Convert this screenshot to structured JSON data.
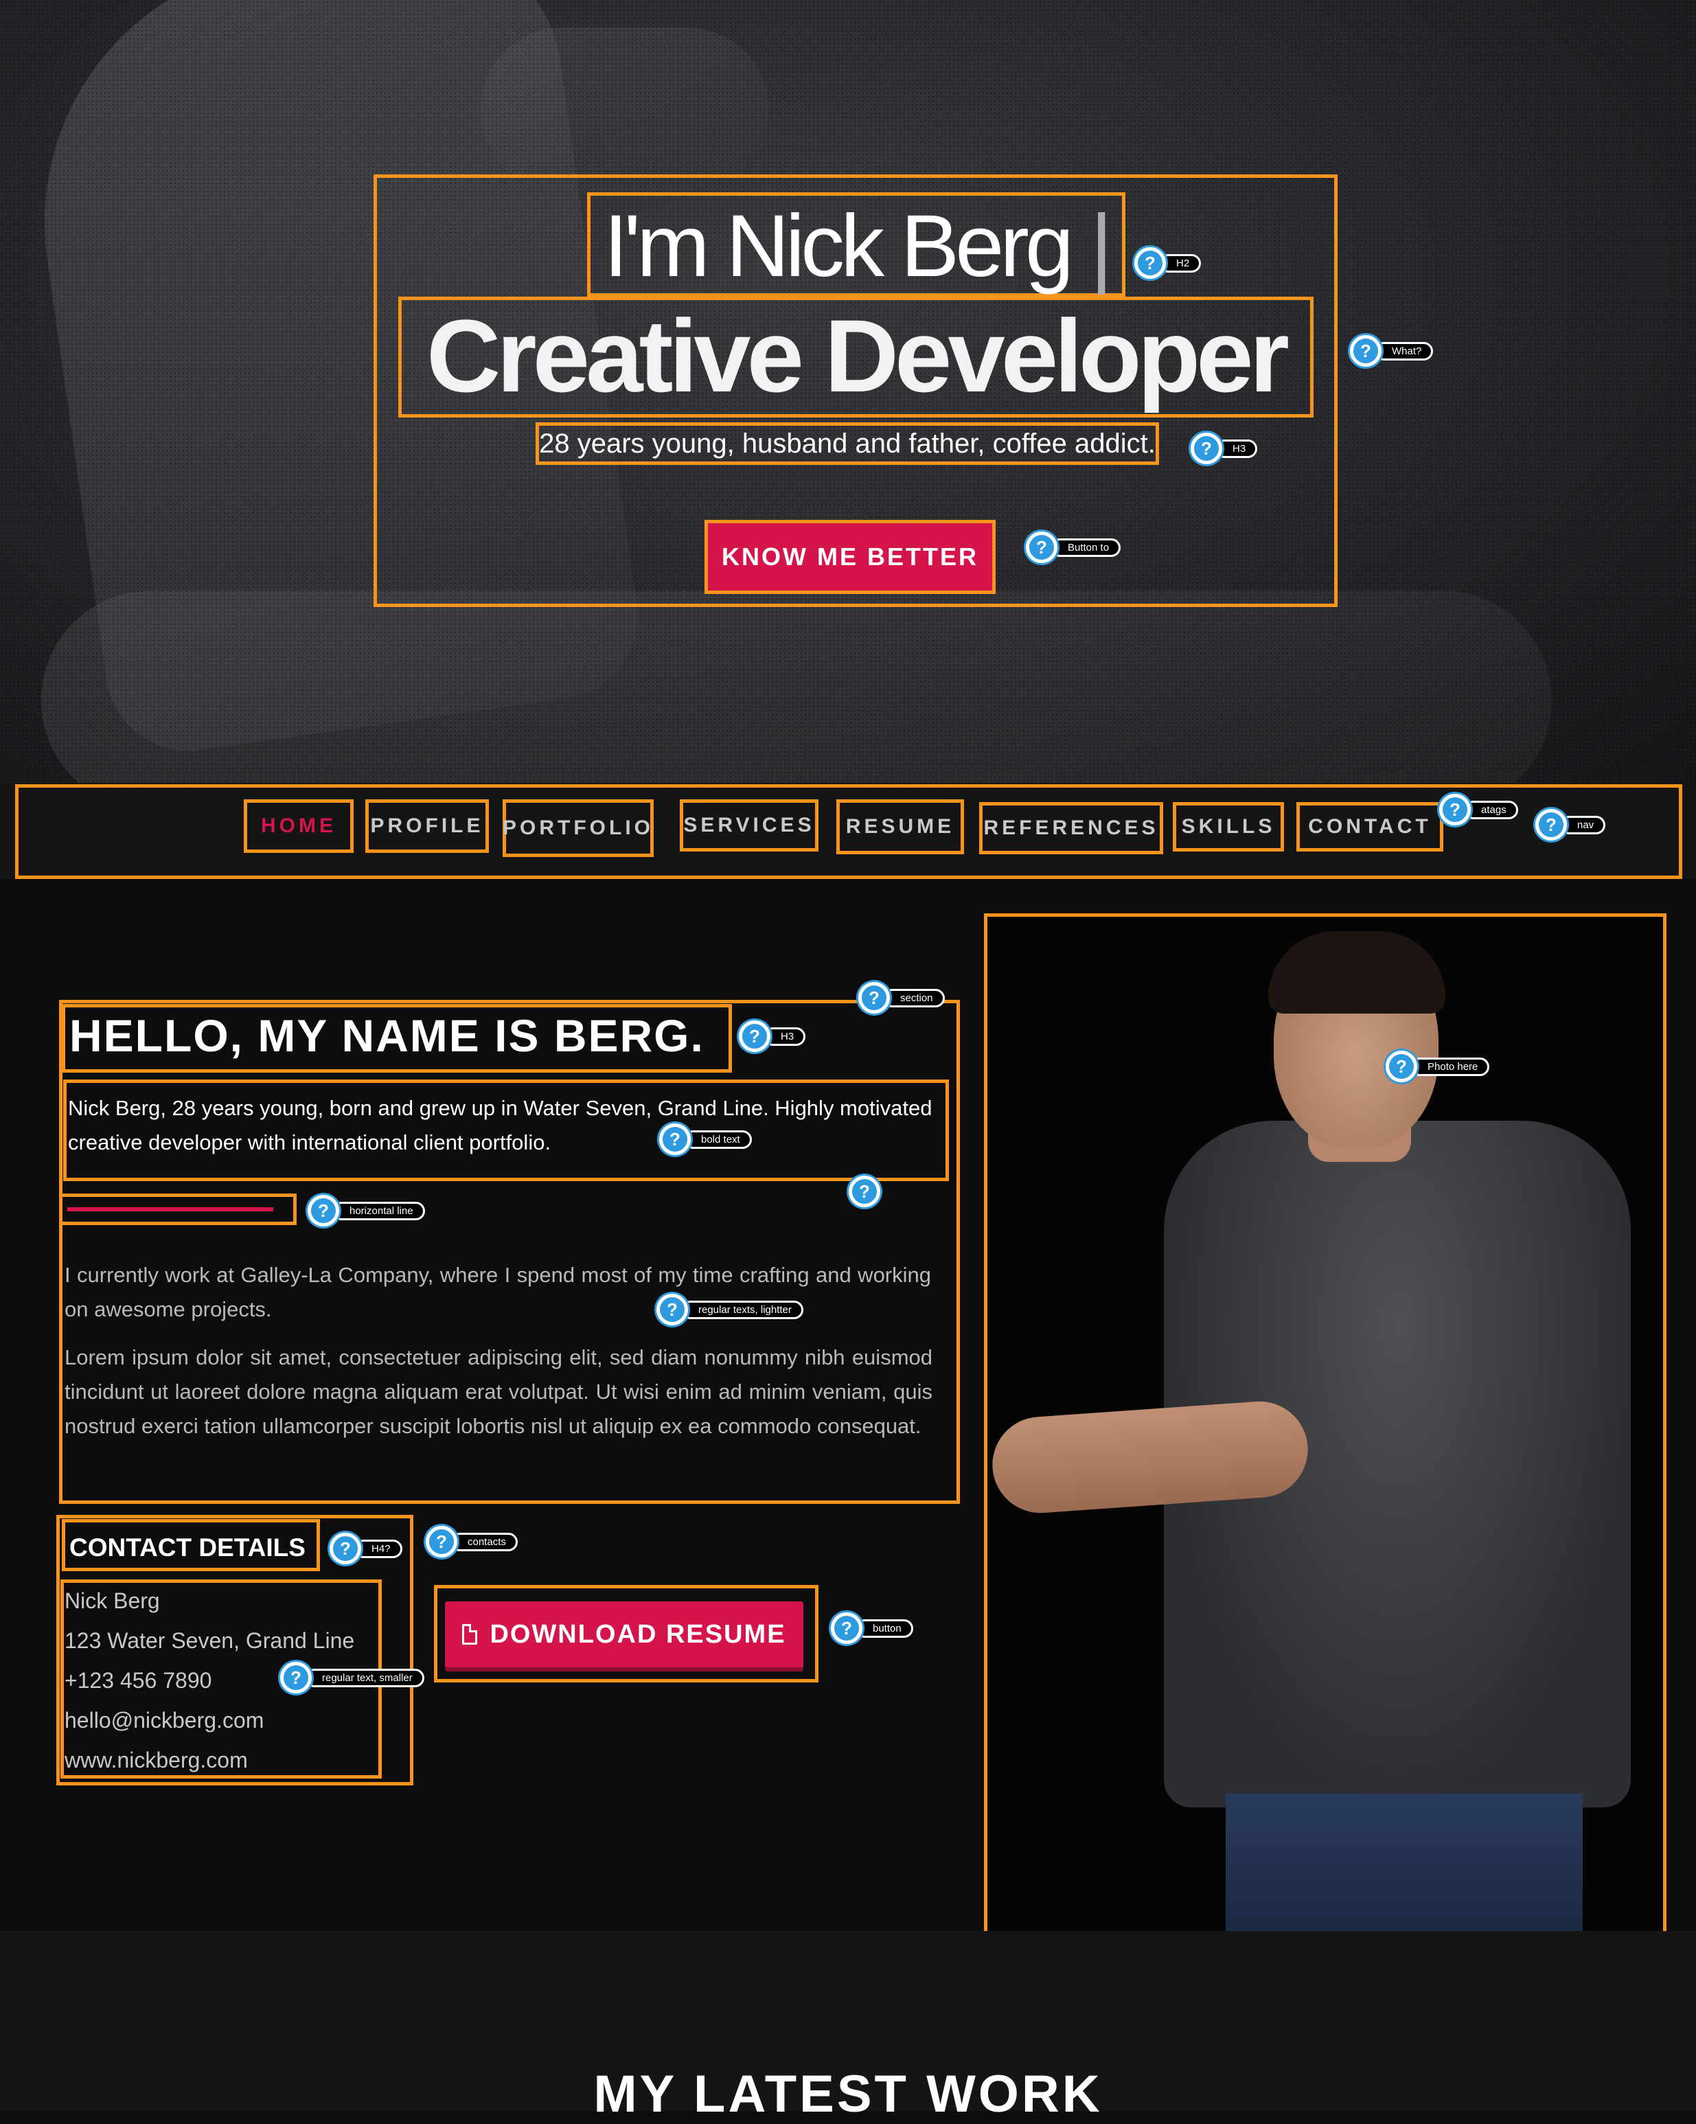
{
  "hero": {
    "name_line": "I'm Nick Berg",
    "role_line": "Creative Developer",
    "tagline": "28 years young, husband and father, coffee addict.",
    "cta_label": "KNOW ME BETTER"
  },
  "annotations": {
    "h2": "H2",
    "what": "What?",
    "h3_hero": "H3",
    "button_to": "Button to",
    "atags": "atags",
    "nav": "nav",
    "section": "section",
    "h3_about": "H3",
    "photo": "Photo here",
    "bold_text": "bold text",
    "horizontal_line": "horizontal line",
    "regular_lighter": "regular texts, lightter",
    "h4": "H4?",
    "contacts": "contacts",
    "regular_smaller": "regular text, smaller",
    "button": "button"
  },
  "nav": {
    "items": [
      {
        "label": "HOME",
        "active": true
      },
      {
        "label": "PROFILE",
        "active": false
      },
      {
        "label": "PORTFOLIO",
        "active": false
      },
      {
        "label": "SERVICES",
        "active": false
      },
      {
        "label": "RESUME",
        "active": false
      },
      {
        "label": "REFERENCES",
        "active": false
      },
      {
        "label": "SKILLS",
        "active": false
      },
      {
        "label": "CONTACT",
        "active": false
      }
    ]
  },
  "about": {
    "heading": "HELLO, MY NAME IS BERG.",
    "intro": "Nick Berg, 28 years young, born and grew up in Water Seven, Grand Line. Highly motivated creative developer with international client portfolio.",
    "para1": "I currently work at Galley-La Company, where I spend most of my time crafting and working on awesome projects.",
    "para2": "Lorem ipsum dolor sit amet, consectetuer adipiscing elit, sed diam nonummy nibh euismod tincidunt ut laoreet dolore magna aliquam erat volutpat. Ut wisi enim ad minim veniam, quis nostrud exerci tation ullamcorper suscipit lobortis nisl ut aliquip ex ea commodo consequat."
  },
  "contact": {
    "heading": "CONTACT DETAILS",
    "name": "Nick Berg",
    "address": "123 Water Seven, Grand Line",
    "phone": "+123 456 7890",
    "email": "hello@nickberg.com",
    "website": "www.nickberg.com",
    "download_label": "DOWNLOAD RESUME"
  },
  "latest": {
    "title": "MY LATEST WORK"
  },
  "colors": {
    "accent": "#d4144b",
    "outline": "#f7941d",
    "tip": "#2e9ae0"
  },
  "icons": {
    "palette": "palette-icon",
    "question": "question-icon",
    "document": "document-icon"
  }
}
